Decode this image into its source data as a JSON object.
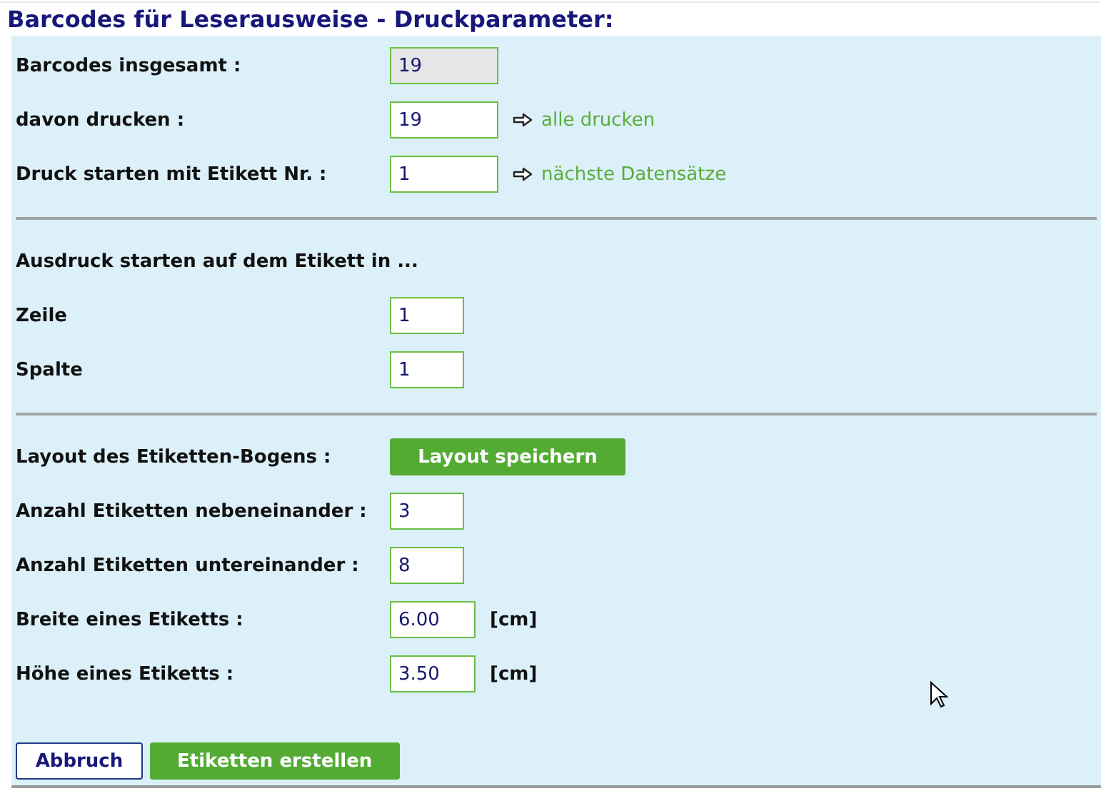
{
  "title": "Barcodes für Leserausweise - Druckparameter:",
  "sections": [
    {
      "rows": [
        {
          "kind": "field",
          "label": "Barcodes insgesamt :",
          "value": "19",
          "readonly": true
        },
        {
          "kind": "field",
          "label": "davon drucken :",
          "value": "19",
          "readonly": false,
          "link": "alle drucken"
        },
        {
          "kind": "field",
          "label": "Druck starten mit Etikett Nr. :",
          "value": "1",
          "readonly": false,
          "link": "nächste Datensätze"
        }
      ]
    },
    {
      "rows": [
        {
          "kind": "heading",
          "label": "Ausdruck starten auf dem Etikett in ..."
        },
        {
          "kind": "field",
          "label": "Zeile",
          "value": "1",
          "readonly": false
        },
        {
          "kind": "field",
          "label": "Spalte",
          "value": "1",
          "readonly": false
        }
      ]
    },
    {
      "rows": [
        {
          "kind": "button",
          "label": "Layout des Etiketten-Bogens :",
          "button": "Layout speichern"
        },
        {
          "kind": "field",
          "label": "Anzahl Etiketten nebeneinander :",
          "value": "3",
          "readonly": false
        },
        {
          "kind": "field",
          "label": "Anzahl Etiketten untereinander :",
          "value": "8",
          "readonly": false
        },
        {
          "kind": "field",
          "label": "Breite eines Etiketts :",
          "value": "6.00",
          "readonly": false,
          "unit": "[cm]"
        },
        {
          "kind": "field",
          "label": "Höhe eines Etiketts :",
          "value": "3.50",
          "readonly": false,
          "unit": "[cm]"
        }
      ]
    }
  ],
  "buttons": [
    {
      "label": "Abbruch",
      "kind": "secondary"
    },
    {
      "label": "Etiketten erstellen",
      "kind": "primary"
    }
  ]
}
